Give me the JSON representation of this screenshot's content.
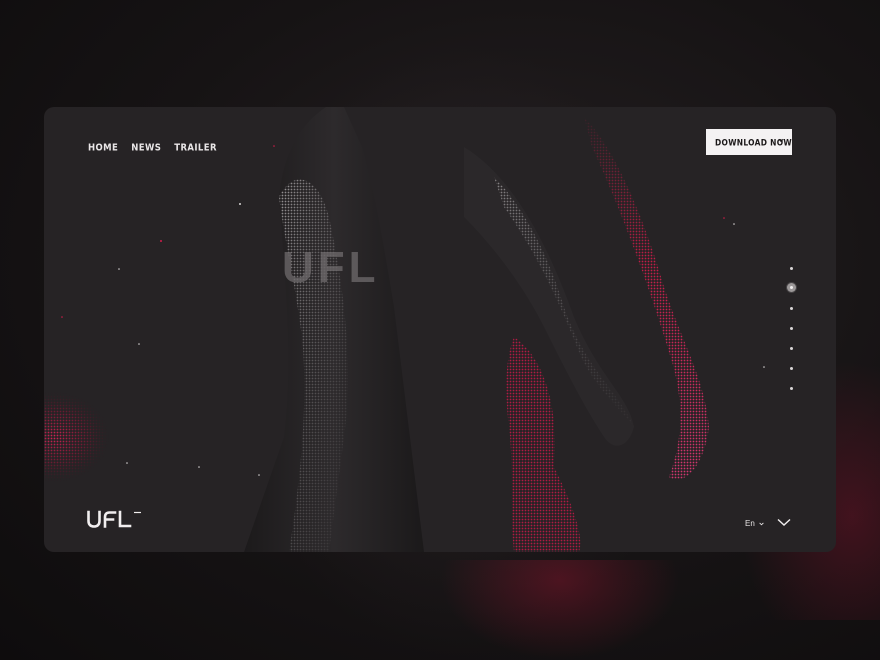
{
  "nav": {
    "items": [
      {
        "label": "HOME"
      },
      {
        "label": "NEWS"
      },
      {
        "label": "TRAILER"
      }
    ]
  },
  "cta": {
    "label": "DOWNLOAD NOW",
    "icon": "chevron-down-icon"
  },
  "brand": {
    "logo_text": "UFL",
    "trademark": "TM",
    "shirt_logo_text": "UFL"
  },
  "pagination": {
    "count": 7,
    "active_index": 1
  },
  "language": {
    "selected": "En",
    "icon": "chevron-down-icon"
  },
  "scroll": {
    "icon": "chevron-down-icon"
  },
  "colors": {
    "background": "#161314",
    "card": "#262325",
    "accent": "#d31c4b",
    "text": "#e9e6e7",
    "button_bg": "#f4f2f3"
  }
}
